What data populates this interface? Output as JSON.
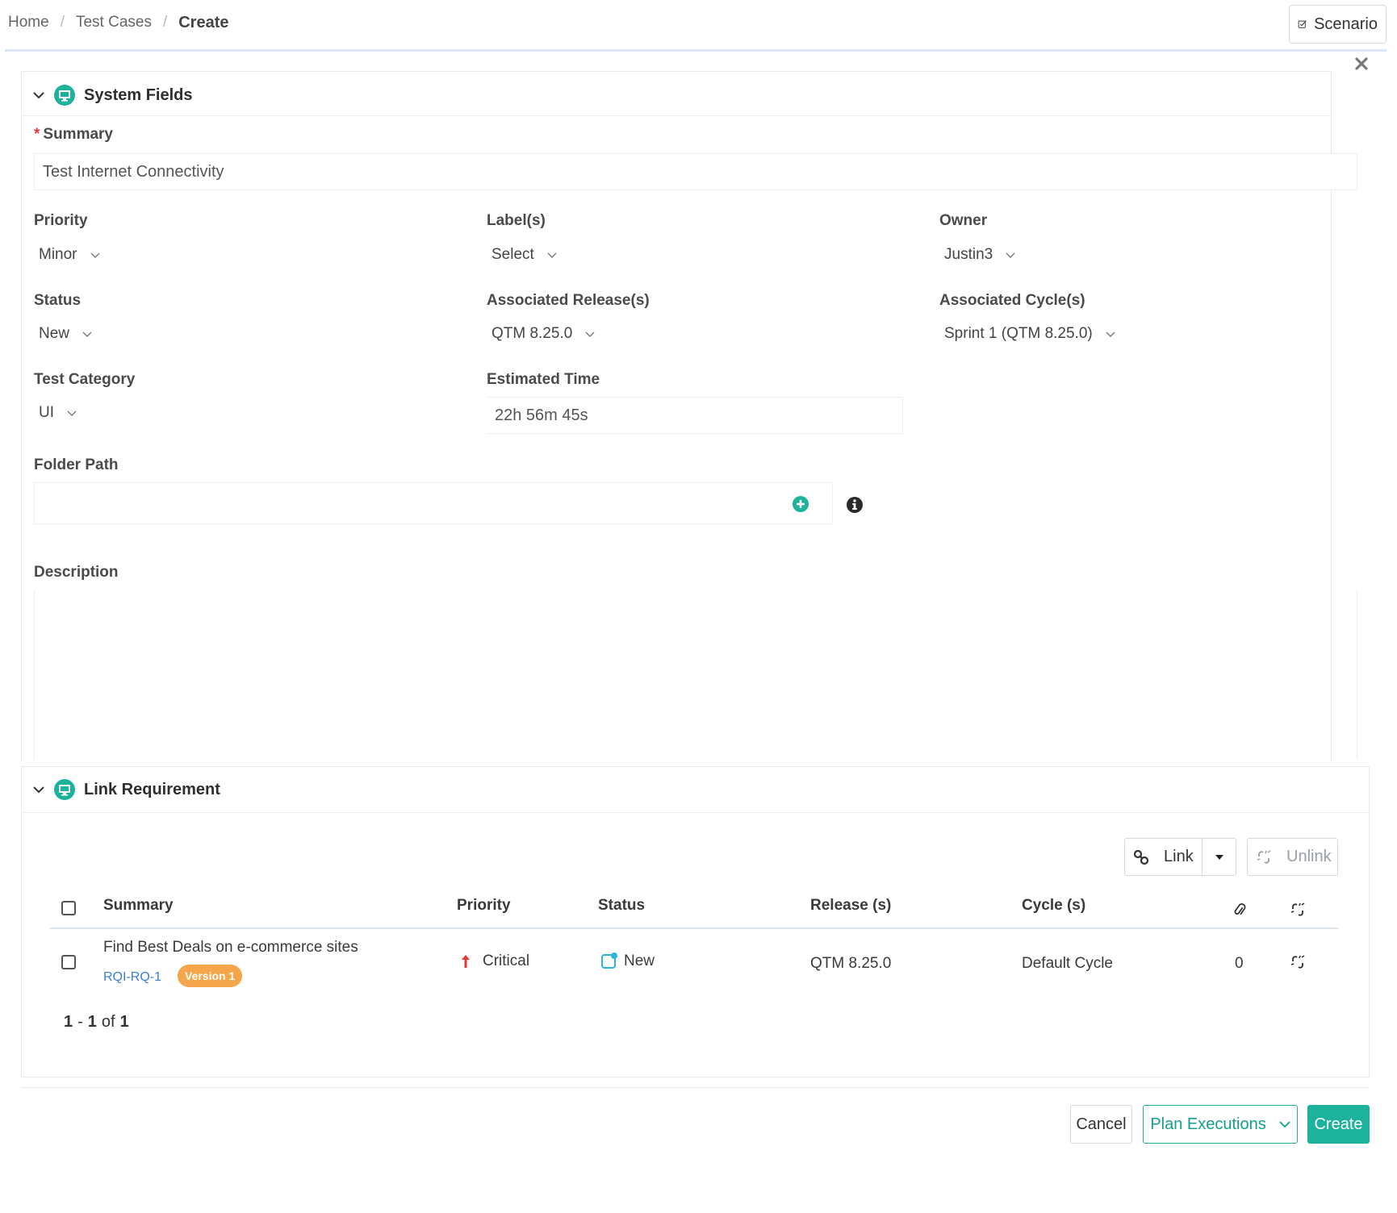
{
  "breadcrumb": {
    "home": "Home",
    "separator": "/",
    "test_cases": "Test Cases",
    "current": "Create"
  },
  "header": {
    "scenario_label": "Scenario",
    "close_icon": "close-icon"
  },
  "system_fields": {
    "title": "System Fields",
    "summary_label": "Summary",
    "required_mark": "*",
    "summary_value": "Test Internet Connectivity",
    "priority_label": "Priority",
    "priority_value": "Minor",
    "labels_label": "Label(s)",
    "labels_value": "Select",
    "owner_label": "Owner",
    "owner_value": "Justin3",
    "status_label": "Status",
    "status_value": "New",
    "release_label": "Associated Release(s)",
    "release_value": "QTM 8.25.0",
    "cycle_label": "Associated Cycle(s)",
    "cycle_value": "Sprint 1 (QTM 8.25.0)",
    "category_label": "Test Category",
    "category_value": "UI",
    "estimated_label": "Estimated Time",
    "estimated_value": "22h 56m 45s",
    "folder_label": "Folder Path",
    "folder_value": "",
    "description_label": "Description",
    "description_value": ""
  },
  "link_requirement": {
    "title": "Link Requirement",
    "link_button": "Link",
    "unlink_button": "Unlink",
    "columns": {
      "summary": "Summary",
      "priority": "Priority",
      "status": "Status",
      "release": "Release (s)",
      "cycle": "Cycle (s)"
    },
    "rows": [
      {
        "summary": "Find Best Deals on e-commerce sites",
        "key": "RQI-RQ-1",
        "version": "Version 1",
        "priority": "Critical",
        "status": "New",
        "release": "QTM 8.25.0",
        "cycle": "Default Cycle",
        "attachments": "0"
      }
    ],
    "pagination": {
      "from": "1",
      "dash": "-",
      "to": "1",
      "of": "of",
      "total": "1"
    }
  },
  "footer": {
    "cancel": "Cancel",
    "plan_executions": "Plan Executions",
    "create": "Create"
  },
  "colors": {
    "teal": "#1db29b",
    "critical": "#e53935",
    "badge": "#f5a64b",
    "link": "#3b7dd8"
  }
}
